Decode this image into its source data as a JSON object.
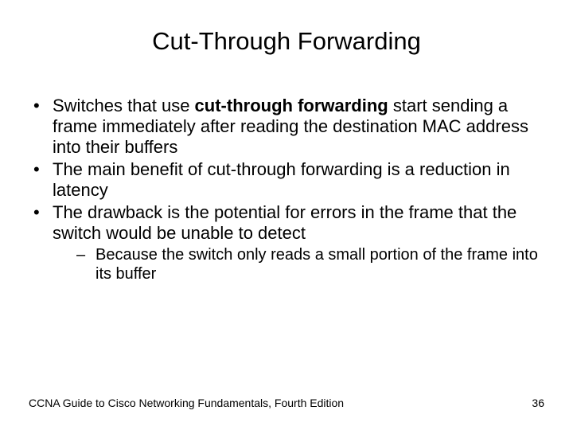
{
  "title": "Cut-Through Forwarding",
  "bullets": [
    {
      "pre": "Switches that use ",
      "bold": "cut-through forwarding",
      "post": " start sending a frame immediately after reading the destination MAC address into their buffers"
    },
    {
      "pre": "The main benefit of cut-through forwarding is a reduction in latency",
      "bold": "",
      "post": ""
    },
    {
      "pre": "The drawback is the potential for errors in the frame that the switch would be unable to detect",
      "bold": "",
      "post": ""
    }
  ],
  "sub_bullets": [
    "Because the switch only reads a small portion of the frame into its buffer"
  ],
  "footer": {
    "source": "CCNA Guide to Cisco Networking Fundamentals, Fourth Edition",
    "page": "36"
  }
}
